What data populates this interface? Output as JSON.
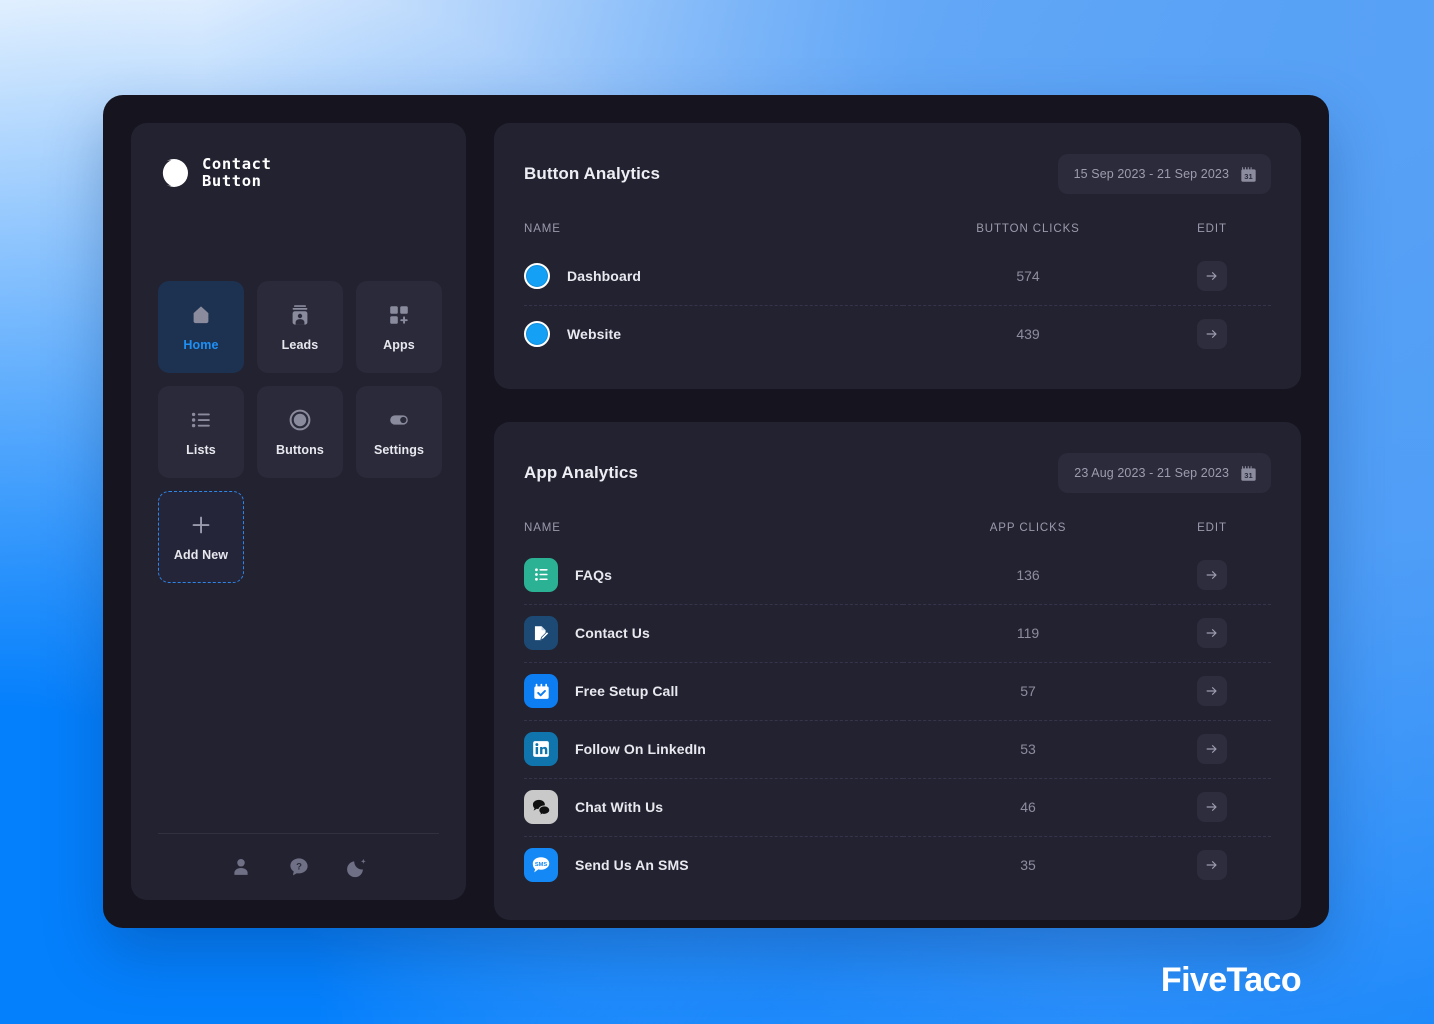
{
  "brand": {
    "line1": "Contact",
    "line2": "Button",
    "logo_icon": "crescent-circle-logo"
  },
  "colors": {
    "accent_blue": "#1E90F5",
    "page_gradient_from": "#F6FAFF",
    "page_gradient_to": "#0B82FC",
    "shell_bg": "#16151F",
    "panel_bg": "#232231",
    "tile_bg": "#2A2A3A",
    "tile_active_bg": "#1D3150",
    "button_disc": "#14A0F5"
  },
  "sidebar": {
    "tiles": [
      {
        "label": "Home",
        "icon": "home-icon",
        "active": true,
        "dashed": false
      },
      {
        "label": "Leads",
        "icon": "contact-card-icon",
        "active": false,
        "dashed": false
      },
      {
        "label": "Apps",
        "icon": "grid-plus-icon",
        "active": false,
        "dashed": false
      },
      {
        "label": "Lists",
        "icon": "list-icon",
        "active": false,
        "dashed": false
      },
      {
        "label": "Buttons",
        "icon": "circle-icon",
        "active": false,
        "dashed": false
      },
      {
        "label": "Settings",
        "icon": "toggle-icon",
        "active": false,
        "dashed": false
      },
      {
        "label": "Add New",
        "icon": "plus-icon",
        "active": false,
        "dashed": true
      }
    ],
    "footer_icons": [
      {
        "icon": "person-icon"
      },
      {
        "icon": "help-bubble-icon"
      },
      {
        "icon": "moon-icon"
      }
    ]
  },
  "button_analytics": {
    "title": "Button Analytics",
    "date_range": "15 Sep 2023 - 21 Sep 2023",
    "date_icon": "calendar-31-icon",
    "columns": [
      "NAME",
      "BUTTON CLICKS",
      "EDIT"
    ],
    "rows": [
      {
        "name": "Dashboard",
        "clicks": "574",
        "icon": "blue-disc-icon",
        "edit_icon": "arrow-right-icon"
      },
      {
        "name": "Website",
        "clicks": "439",
        "icon": "blue-disc-icon",
        "edit_icon": "arrow-right-icon"
      }
    ]
  },
  "app_analytics": {
    "title": "App Analytics",
    "date_range": "23 Aug 2023 - 21 Sep 2023",
    "date_icon": "calendar-31-icon",
    "columns": [
      "NAME",
      "APP CLICKS",
      "EDIT"
    ],
    "rows": [
      {
        "name": "FAQs",
        "clicks": "136",
        "icon": "faq-list-icon",
        "icon_color": "#2BB193",
        "edit_icon": "arrow-right-icon"
      },
      {
        "name": "Contact Us",
        "clicks": "119",
        "icon": "form-pencil-icon",
        "icon_color": "#1C4A74",
        "edit_icon": "arrow-right-icon"
      },
      {
        "name": "Free Setup Call",
        "clicks": "57",
        "icon": "calendar-check-icon",
        "icon_color": "#0D7DF2",
        "edit_icon": "arrow-right-icon"
      },
      {
        "name": "Follow On LinkedIn",
        "clicks": "53",
        "icon": "linkedin-icon",
        "icon_color": "#1175AD",
        "edit_icon": "arrow-right-icon"
      },
      {
        "name": "Chat With Us",
        "clicks": "46",
        "icon": "chat-bubbles-icon",
        "icon_color": "#C9C9C9",
        "edit_icon": "arrow-right-icon"
      },
      {
        "name": "Send Us An SMS",
        "clicks": "35",
        "icon": "sms-bubble-icon",
        "icon_color": "#1489F5",
        "edit_icon": "arrow-right-icon"
      }
    ]
  },
  "watermark": {
    "text": "FiveTaco"
  }
}
